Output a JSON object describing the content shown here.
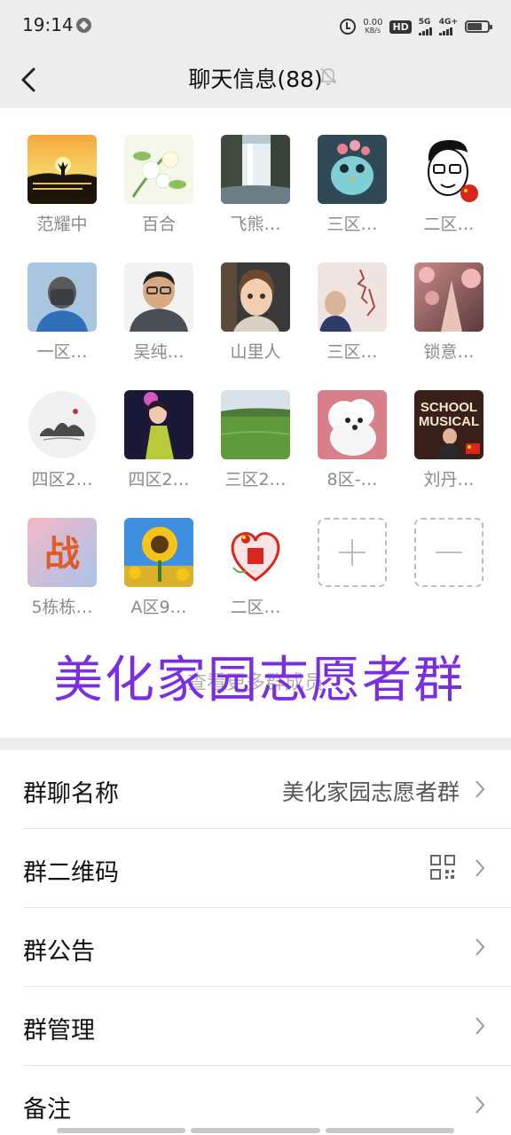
{
  "status_bar": {
    "time": "19:14",
    "net_speed_value": "0.00",
    "net_speed_unit": "KB/s",
    "hd_label": "HD",
    "hd_sub": "1 2",
    "sim1_label": "5G",
    "sim2_label": "4G+"
  },
  "header": {
    "title": "聊天信息(88)"
  },
  "members": [
    {
      "name": "范耀中",
      "avatar": "sunset-silhouette-photo"
    },
    {
      "name": "百合",
      "avatar": "flowers-photo"
    },
    {
      "name": "飞熊…",
      "avatar": "waterfall-photo"
    },
    {
      "name": "三区…",
      "avatar": "cartoon-bird-image"
    },
    {
      "name": "二区…",
      "avatar": "cartoon-face-drawing"
    },
    {
      "name": "一区…",
      "avatar": "masked-man-photo"
    },
    {
      "name": "吴纯…",
      "avatar": "man-glasses-photo"
    },
    {
      "name": "山里人",
      "avatar": "anime-girl-image"
    },
    {
      "name": "三区…",
      "avatar": "woman-calligraphy-photo"
    },
    {
      "name": "锁意…",
      "avatar": "cherry-blossom-path-photo"
    },
    {
      "name": "四区2…",
      "avatar": "ink-landscape-circle"
    },
    {
      "name": "四区2…",
      "avatar": "dancer-photo"
    },
    {
      "name": "三区2…",
      "avatar": "green-field-photo"
    },
    {
      "name": "8区-…",
      "avatar": "white-poodle-photo"
    },
    {
      "name": "刘丹…",
      "avatar": "school-musical-poster"
    },
    {
      "name": "5栋栋…",
      "avatar": "calligraphy-zhan-image"
    },
    {
      "name": "A区9…",
      "avatar": "sunflower-photo"
    },
    {
      "name": "二区…",
      "avatar": "heart-flag-emblem"
    }
  ],
  "more_members_text": "查看更多群成员",
  "overlay_title": "美化家园志愿者群",
  "avatar_zhan_char": "战",
  "avatar_school_text": "SCHOOL MUSICAL",
  "settings": {
    "group_name_label": "群聊名称",
    "group_name_value": "美化家园志愿者群",
    "qr_label": "群二维码",
    "notice_label": "群公告",
    "manage_label": "群管理",
    "remark_label": "备注"
  },
  "colors": {
    "header_bg": "#ededed",
    "overlay_purple": "#7a2ee0",
    "member_name_gray": "#8a8a8a"
  }
}
